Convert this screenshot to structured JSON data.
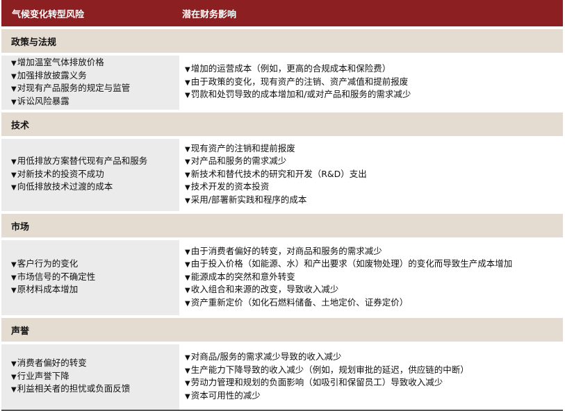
{
  "header": {
    "col1": "气候变化转型风险",
    "col2": "潜在财务影响"
  },
  "bullet": "▼",
  "sections": [
    {
      "title": "政策与法规",
      "risks": [
        "增加温室气体排放价格",
        "加强排放披露义务",
        "对现有产品服务的规定与监管",
        "诉讼风险暴露"
      ],
      "impacts": [
        "增加的运营成本（例如，更高的合规成本和保险费）",
        "由于政策的变化，现有资产的注销、资产减值和提前报废",
        "罚款和处罚导致的成本增加和/或对产品和服务的需求减少"
      ]
    },
    {
      "title": "技术",
      "risks": [
        "用低排放方案替代现有产品和服务",
        "对新技术的投资不成功",
        "向低排放技术过渡的成本"
      ],
      "impacts": [
        "现有资产的注销和提前报废",
        "对产品和服务的需求减少",
        "新技术和替代技术的研究和开发（R&D）支出",
        "技术开发的资本投资",
        "采用/部署新实践和程序的成本"
      ]
    },
    {
      "title": "市场",
      "risks": [
        "客户行为的变化",
        "市场信号的不确定性",
        "原材料成本增加"
      ],
      "impacts": [
        "由于消费者偏好的转变，对商品和服务的需求减少",
        "由于投入价格（如能源、水）和产出要求（如废物处理）的变化而导致生产成本增加",
        "能源成本的突然和意外转变",
        "收入组合和来源的改变，导致收入减少",
        "资产重新定价（如化石燃料储备、土地定价、证券定价）"
      ]
    },
    {
      "title": "声誉",
      "risks": [
        "消费者偏好的转变",
        "行业声誉下降",
        "利益相关者的担忧或负面反馈"
      ],
      "impacts": [
        "对商品/服务的需求减少导致的收入减少",
        "生产能力下降导致的收入减少（例如，规划审批的延迟，供应链的中断）",
        "劳动力管理和规划的负面影响（如吸引和保留员工）导致收入减少",
        "资本可用性的减少"
      ]
    }
  ]
}
